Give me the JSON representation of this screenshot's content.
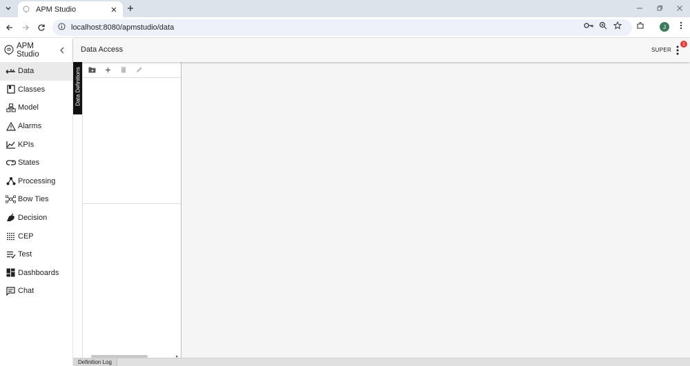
{
  "browser": {
    "tab_title": "APM Studio",
    "url": "localhost:8080/apmstudio/data",
    "profile_initial": "J"
  },
  "app": {
    "name": "APM Studio",
    "page_title": "Data Access",
    "user": "SUPER",
    "notification_count": "1"
  },
  "sidebar": {
    "items": [
      {
        "label": "Data",
        "icon": "data-flow-icon"
      },
      {
        "label": "Classes",
        "icon": "book-icon"
      },
      {
        "label": "Model",
        "icon": "hierarchy-icon"
      },
      {
        "label": "Alarms",
        "icon": "warning-icon"
      },
      {
        "label": "KPIs",
        "icon": "trend-icon"
      },
      {
        "label": "States",
        "icon": "link-icon"
      },
      {
        "label": "Processing",
        "icon": "nodes-icon"
      },
      {
        "label": "Bow Ties",
        "icon": "bowtie-icon"
      },
      {
        "label": "Decision",
        "icon": "decision-icon"
      },
      {
        "label": "CEP",
        "icon": "cep-icon"
      },
      {
        "label": "Test",
        "icon": "checklist-icon"
      },
      {
        "label": "Dashboards",
        "icon": "dashboard-icon"
      },
      {
        "label": "Chat",
        "icon": "chat-icon"
      }
    ]
  },
  "panel": {
    "vertical_tab": "Data Definitions",
    "bottom_tab": "Definition Log"
  }
}
